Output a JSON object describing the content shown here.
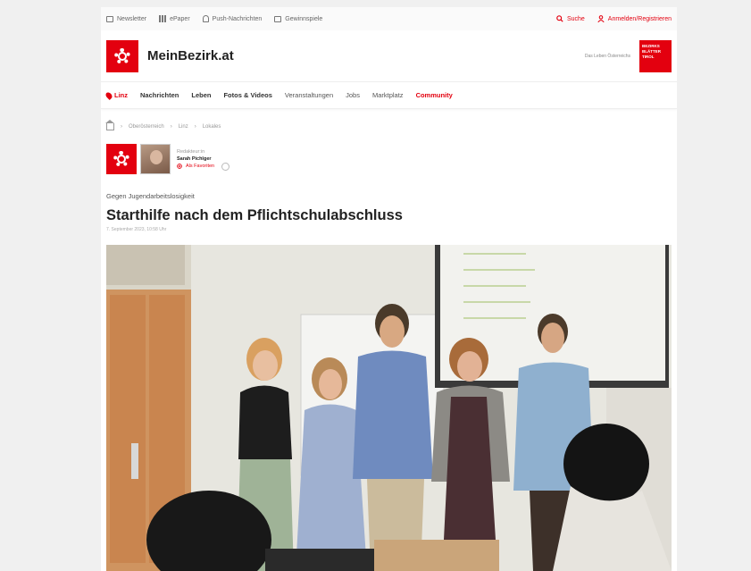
{
  "topbar": {
    "newsletter": "Newsletter",
    "epaper": "ePaper",
    "push": "Push-Nachrichten",
    "gewinnspiel": "Gewinnspiele",
    "search": "Suche",
    "login": "Anmelden/Registrieren"
  },
  "brand": {
    "name": "MeinBezirk.at",
    "tagline": "Das Leben Österreichs",
    "badge": "BEZIRKS BLÄTTER TIROL"
  },
  "nav": {
    "region": "Linz",
    "items": [
      "Nachrichten",
      "Leben",
      "Fotos & Videos",
      "Veranstaltungen",
      "Jobs",
      "Marktplatz"
    ],
    "community": "Community"
  },
  "breadcrumb": [
    "Oberösterreich",
    "Linz",
    "Lokales"
  ],
  "author": {
    "role": "Redakteur:in",
    "name": "Sarah Pichlger",
    "follow": "Als Favoriten"
  },
  "article": {
    "kicker": "Gegen Jugendarbeitslosigkeit",
    "title": "Starthilfe nach dem Pflichtschulabschluss",
    "date": "7. September 2023, 10:58 Uhr"
  },
  "colors": {
    "accent": "#e3000f"
  }
}
